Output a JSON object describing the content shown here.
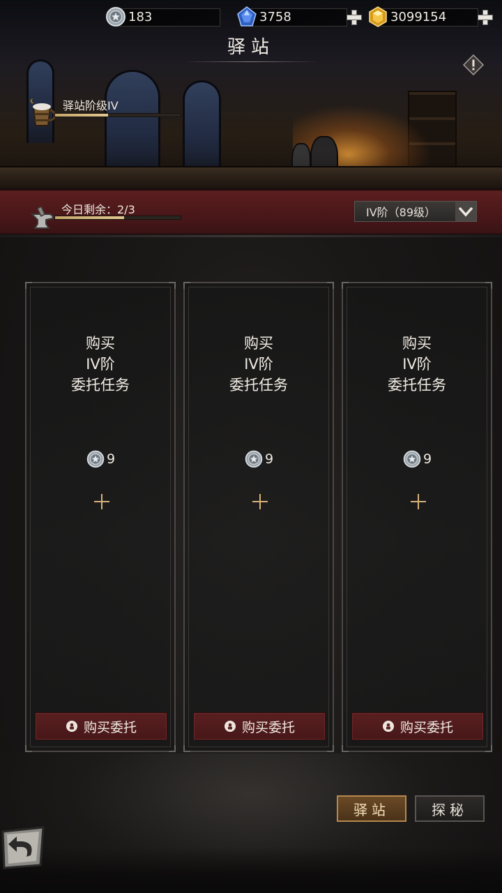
{
  "header": {
    "title": "驿站",
    "currencies": [
      {
        "icon": "silver-coin-icon",
        "value": "183"
      },
      {
        "icon": "blue-gem-icon",
        "value": "3758"
      },
      {
        "icon": "gold-gem-icon",
        "value": "3099154"
      }
    ]
  },
  "station": {
    "level_label": "驿站阶级IV",
    "level_progress": 0.42
  },
  "quota": {
    "label": "今日剩余：2/3",
    "progress": 0.55
  },
  "tier_selector": {
    "selected": "IV阶（89级）"
  },
  "cards": [
    {
      "line1": "购买",
      "line2": "IV阶",
      "line3": "委托任务",
      "cost": "9",
      "button": "购买委托"
    },
    {
      "line1": "购买",
      "line2": "IV阶",
      "line3": "委托任务",
      "cost": "9",
      "button": "购买委托"
    },
    {
      "line1": "购买",
      "line2": "IV阶",
      "line3": "委托任务",
      "cost": "9",
      "button": "购买委托"
    }
  ],
  "tabs": [
    {
      "label": "驿站",
      "active": true
    },
    {
      "label": "探秘",
      "active": false
    }
  ],
  "colors": {
    "accent_gold": "#d9b27a",
    "strip_red": "#4a1719",
    "button_red": "#5a1f20"
  }
}
